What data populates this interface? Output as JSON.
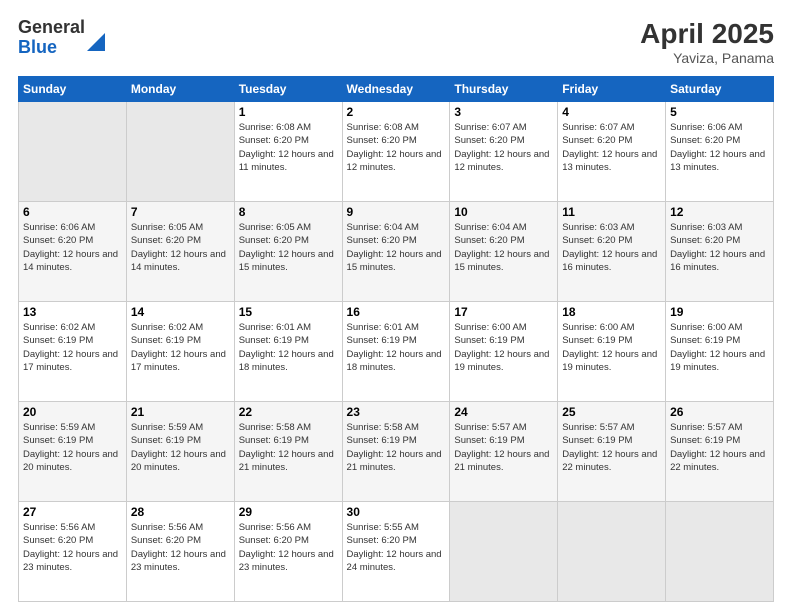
{
  "logo": {
    "general": "General",
    "blue": "Blue"
  },
  "header": {
    "title": "April 2025",
    "location": "Yaviza, Panama"
  },
  "weekdays": [
    "Sunday",
    "Monday",
    "Tuesday",
    "Wednesday",
    "Thursday",
    "Friday",
    "Saturday"
  ],
  "weeks": [
    [
      {
        "day": "",
        "info": ""
      },
      {
        "day": "",
        "info": ""
      },
      {
        "day": "1",
        "info": "Sunrise: 6:08 AM\nSunset: 6:20 PM\nDaylight: 12 hours and 11 minutes."
      },
      {
        "day": "2",
        "info": "Sunrise: 6:08 AM\nSunset: 6:20 PM\nDaylight: 12 hours and 12 minutes."
      },
      {
        "day": "3",
        "info": "Sunrise: 6:07 AM\nSunset: 6:20 PM\nDaylight: 12 hours and 12 minutes."
      },
      {
        "day": "4",
        "info": "Sunrise: 6:07 AM\nSunset: 6:20 PM\nDaylight: 12 hours and 13 minutes."
      },
      {
        "day": "5",
        "info": "Sunrise: 6:06 AM\nSunset: 6:20 PM\nDaylight: 12 hours and 13 minutes."
      }
    ],
    [
      {
        "day": "6",
        "info": "Sunrise: 6:06 AM\nSunset: 6:20 PM\nDaylight: 12 hours and 14 minutes."
      },
      {
        "day": "7",
        "info": "Sunrise: 6:05 AM\nSunset: 6:20 PM\nDaylight: 12 hours and 14 minutes."
      },
      {
        "day": "8",
        "info": "Sunrise: 6:05 AM\nSunset: 6:20 PM\nDaylight: 12 hours and 15 minutes."
      },
      {
        "day": "9",
        "info": "Sunrise: 6:04 AM\nSunset: 6:20 PM\nDaylight: 12 hours and 15 minutes."
      },
      {
        "day": "10",
        "info": "Sunrise: 6:04 AM\nSunset: 6:20 PM\nDaylight: 12 hours and 15 minutes."
      },
      {
        "day": "11",
        "info": "Sunrise: 6:03 AM\nSunset: 6:20 PM\nDaylight: 12 hours and 16 minutes."
      },
      {
        "day": "12",
        "info": "Sunrise: 6:03 AM\nSunset: 6:20 PM\nDaylight: 12 hours and 16 minutes."
      }
    ],
    [
      {
        "day": "13",
        "info": "Sunrise: 6:02 AM\nSunset: 6:19 PM\nDaylight: 12 hours and 17 minutes."
      },
      {
        "day": "14",
        "info": "Sunrise: 6:02 AM\nSunset: 6:19 PM\nDaylight: 12 hours and 17 minutes."
      },
      {
        "day": "15",
        "info": "Sunrise: 6:01 AM\nSunset: 6:19 PM\nDaylight: 12 hours and 18 minutes."
      },
      {
        "day": "16",
        "info": "Sunrise: 6:01 AM\nSunset: 6:19 PM\nDaylight: 12 hours and 18 minutes."
      },
      {
        "day": "17",
        "info": "Sunrise: 6:00 AM\nSunset: 6:19 PM\nDaylight: 12 hours and 19 minutes."
      },
      {
        "day": "18",
        "info": "Sunrise: 6:00 AM\nSunset: 6:19 PM\nDaylight: 12 hours and 19 minutes."
      },
      {
        "day": "19",
        "info": "Sunrise: 6:00 AM\nSunset: 6:19 PM\nDaylight: 12 hours and 19 minutes."
      }
    ],
    [
      {
        "day": "20",
        "info": "Sunrise: 5:59 AM\nSunset: 6:19 PM\nDaylight: 12 hours and 20 minutes."
      },
      {
        "day": "21",
        "info": "Sunrise: 5:59 AM\nSunset: 6:19 PM\nDaylight: 12 hours and 20 minutes."
      },
      {
        "day": "22",
        "info": "Sunrise: 5:58 AM\nSunset: 6:19 PM\nDaylight: 12 hours and 21 minutes."
      },
      {
        "day": "23",
        "info": "Sunrise: 5:58 AM\nSunset: 6:19 PM\nDaylight: 12 hours and 21 minutes."
      },
      {
        "day": "24",
        "info": "Sunrise: 5:57 AM\nSunset: 6:19 PM\nDaylight: 12 hours and 21 minutes."
      },
      {
        "day": "25",
        "info": "Sunrise: 5:57 AM\nSunset: 6:19 PM\nDaylight: 12 hours and 22 minutes."
      },
      {
        "day": "26",
        "info": "Sunrise: 5:57 AM\nSunset: 6:19 PM\nDaylight: 12 hours and 22 minutes."
      }
    ],
    [
      {
        "day": "27",
        "info": "Sunrise: 5:56 AM\nSunset: 6:20 PM\nDaylight: 12 hours and 23 minutes."
      },
      {
        "day": "28",
        "info": "Sunrise: 5:56 AM\nSunset: 6:20 PM\nDaylight: 12 hours and 23 minutes."
      },
      {
        "day": "29",
        "info": "Sunrise: 5:56 AM\nSunset: 6:20 PM\nDaylight: 12 hours and 23 minutes."
      },
      {
        "day": "30",
        "info": "Sunrise: 5:55 AM\nSunset: 6:20 PM\nDaylight: 12 hours and 24 minutes."
      },
      {
        "day": "",
        "info": ""
      },
      {
        "day": "",
        "info": ""
      },
      {
        "day": "",
        "info": ""
      }
    ]
  ]
}
